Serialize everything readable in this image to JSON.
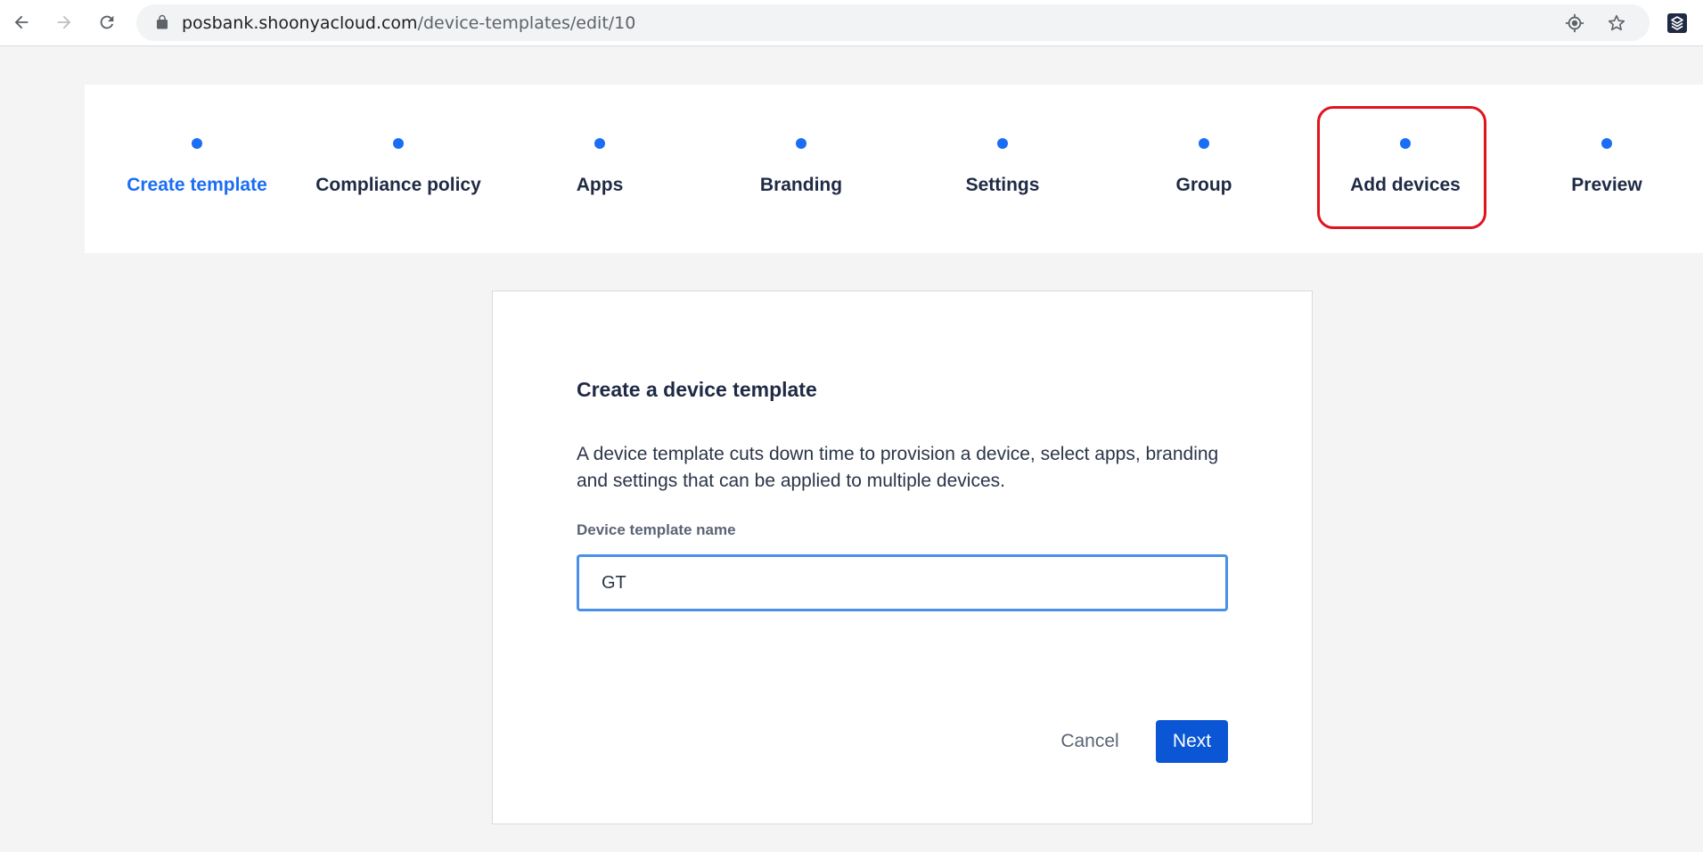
{
  "browser": {
    "url_host": "posbank.shoonyacloud.com",
    "url_path": "/device-templates/edit/10"
  },
  "steps": [
    {
      "label": "Create template",
      "active": true
    },
    {
      "label": "Compliance policy",
      "active": false
    },
    {
      "label": "Apps",
      "active": false
    },
    {
      "label": "Branding",
      "active": false
    },
    {
      "label": "Settings",
      "active": false
    },
    {
      "label": "Group",
      "active": false
    },
    {
      "label": "Add devices",
      "active": false
    },
    {
      "label": "Preview",
      "active": false
    }
  ],
  "card": {
    "title": "Create a device template",
    "description": "A device template cuts down time to provision a device, select apps, branding and settings that can be applied to multiple devices.",
    "field_label": "Device template name",
    "field_value": "GT",
    "cancel_label": "Cancel",
    "next_label": "Next"
  },
  "colors": {
    "accent": "#1a6ef5",
    "primary_button": "#0a56d4",
    "highlight": "#e0141e"
  }
}
